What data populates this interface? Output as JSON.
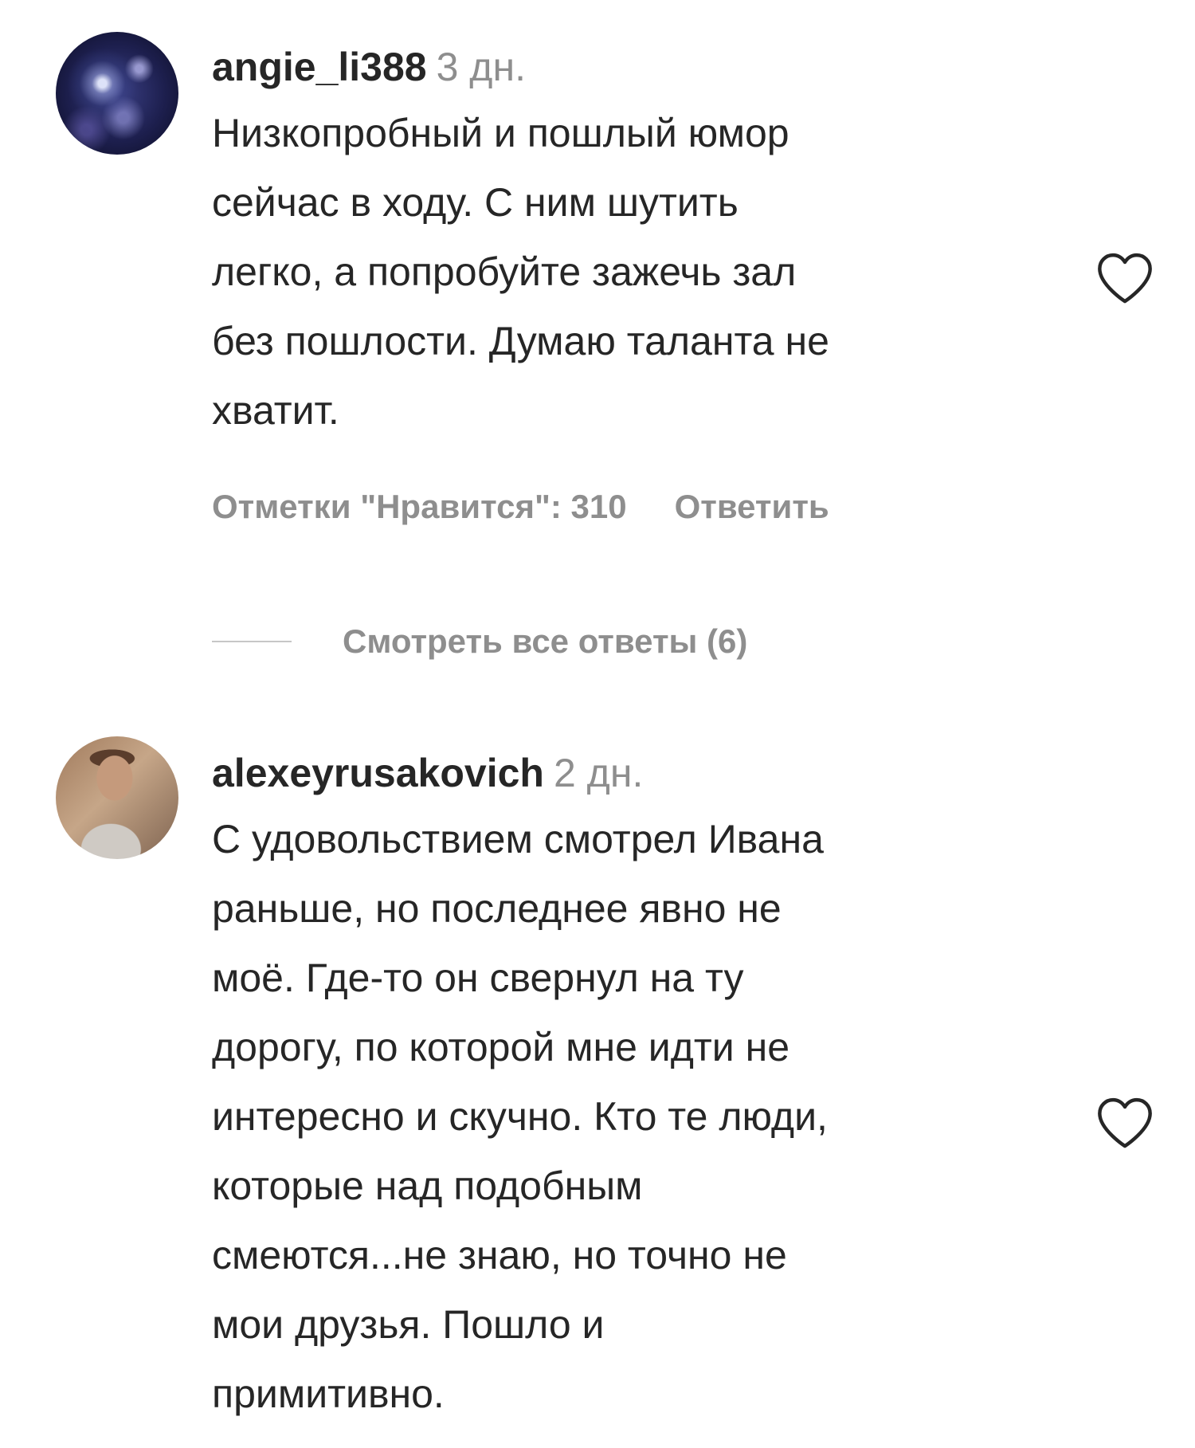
{
  "comments": [
    {
      "username": "angie_li388",
      "time": "3 дн.",
      "text": "Низкопробный и пошлый юмор\nсейчас в ходу. С ним шутить\nлегко, а попробуйте зажечь зал\nбез пошлости. Думаю таланта не\nхватит.",
      "likes_label": "Отметки \"Нравится\": 310",
      "reply_label": "Ответить",
      "view_replies_label": "Смотреть все ответы (6)",
      "heart_icon": "heart-outline-icon"
    },
    {
      "username": "alexeyrusakovich",
      "time": "2 дн.",
      "text": "С удовольствием смотрел Ивана\nраньше, но последнее явно не\nмоё. Где-то он свернул на ту\nдорогу, по которой мне идти не\nинтересно и скучно. Кто те люди,\nкоторые над подобным\nсмеются...не знаю, но точно не\nмои друзья. Пошло и\nпримитивно.",
      "heart_icon": "heart-outline-icon"
    }
  ],
  "colors": {
    "text_primary": "#262626",
    "text_secondary": "#8e8e8e",
    "divider": "#c7c7c7",
    "background": "#ffffff"
  }
}
